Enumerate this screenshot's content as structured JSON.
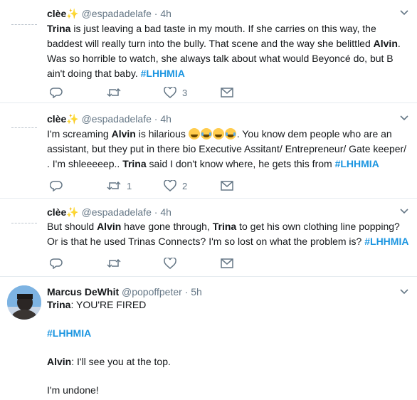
{
  "tweets": [
    {
      "name": "clèe",
      "sparkle": "✨",
      "handle": "@espadadelafe",
      "dot": "·",
      "time": "4h",
      "body": [
        {
          "t": "b",
          "v": "Trina"
        },
        {
          "t": "s",
          "v": " is just leaving a bad taste in my mouth. If she carries on this way, the baddest will really turn into the bully. That scene and the way she belittled "
        },
        {
          "t": "b",
          "v": "Alvin"
        },
        {
          "t": "s",
          "v": ". Was so horrible to watch, she always talk about what would Beyoncé do, but B ain't doing that baby. "
        },
        {
          "t": "h",
          "v": "#LHHMIA"
        }
      ],
      "reply_count": "",
      "retweet_count": "",
      "like_count": "3"
    },
    {
      "name": "clèe",
      "sparkle": "✨",
      "handle": "@espadadelafe",
      "dot": "·",
      "time": "4h",
      "body": [
        {
          "t": "s",
          "v": "I'm screaming "
        },
        {
          "t": "b",
          "v": "Alvin"
        },
        {
          "t": "s",
          "v": " is hilarious "
        },
        {
          "t": "e",
          "v": "grinning-sweat-emoji"
        },
        {
          "t": "e2",
          "v": "tears-of-joy-emoji"
        },
        {
          "t": "e",
          "v": "grinning-sweat-emoji"
        },
        {
          "t": "e2",
          "v": "tears-of-joy-emoji"
        },
        {
          "t": "s",
          "v": ". You know dem people who are an assistant, but they put in there bio Executive Assitant/ Entrepreneur/ Gate keeper/ . I'm shleeeeep.. "
        },
        {
          "t": "b",
          "v": "Trina"
        },
        {
          "t": "s",
          "v": " said I don't know where, he gets this from "
        },
        {
          "t": "h",
          "v": "#LHHMIA"
        }
      ],
      "reply_count": "",
      "retweet_count": "1",
      "like_count": "2"
    },
    {
      "name": "clèe",
      "sparkle": "✨",
      "handle": "@espadadelafe",
      "dot": "·",
      "time": "4h",
      "body": [
        {
          "t": "s",
          "v": "But should "
        },
        {
          "t": "b",
          "v": "Alvin"
        },
        {
          "t": "s",
          "v": " have gone through,  "
        },
        {
          "t": "b",
          "v": "Trina"
        },
        {
          "t": "s",
          "v": " to get his own clothing line popping? Or is that he used Trinas Connects? I'm so lost on what the problem is? "
        },
        {
          "t": "h",
          "v": "#LHHMIA"
        }
      ],
      "reply_count": "",
      "retweet_count": "",
      "like_count": ""
    },
    {
      "name": "Marcus DeWhit",
      "sparkle": "",
      "handle": "@popoffpeter",
      "dot": "·",
      "time": "5h",
      "lines": [
        [
          {
            "t": "b",
            "v": "Trina"
          },
          {
            "t": "s",
            "v": ": YOU'RE FIRED"
          }
        ],
        [
          {
            "t": "h",
            "v": "#LHHMIA"
          }
        ],
        [
          {
            "t": "b",
            "v": "Alvin"
          },
          {
            "t": "s",
            "v": ": I'll see you at the top."
          }
        ],
        [
          {
            "t": "s",
            "v": "I'm undone!"
          }
        ]
      ]
    }
  ]
}
